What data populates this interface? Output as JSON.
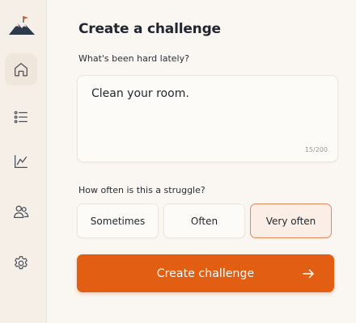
{
  "sidebar": {
    "items": [
      {
        "name": "home",
        "icon": "home-icon",
        "active": true
      },
      {
        "name": "list",
        "icon": "list-icon",
        "active": false
      },
      {
        "name": "stats",
        "icon": "chart-icon",
        "active": false
      },
      {
        "name": "people",
        "icon": "users-icon",
        "active": false
      },
      {
        "name": "settings",
        "icon": "gear-icon",
        "active": false
      }
    ]
  },
  "page": {
    "title": "Create a challenge"
  },
  "form": {
    "hard_question": "What's been hard lately?",
    "hard_value": "Clean your room.",
    "char_count": "15/200",
    "frequency_question": "How often is this a struggle?",
    "frequency_options": [
      "Sometimes",
      "Often",
      "Very often"
    ],
    "frequency_selected": "Very often",
    "submit_label": "Create challenge"
  },
  "colors": {
    "accent": "#e25e13",
    "background": "#faf6f1",
    "selected_border": "#e58a5a"
  }
}
